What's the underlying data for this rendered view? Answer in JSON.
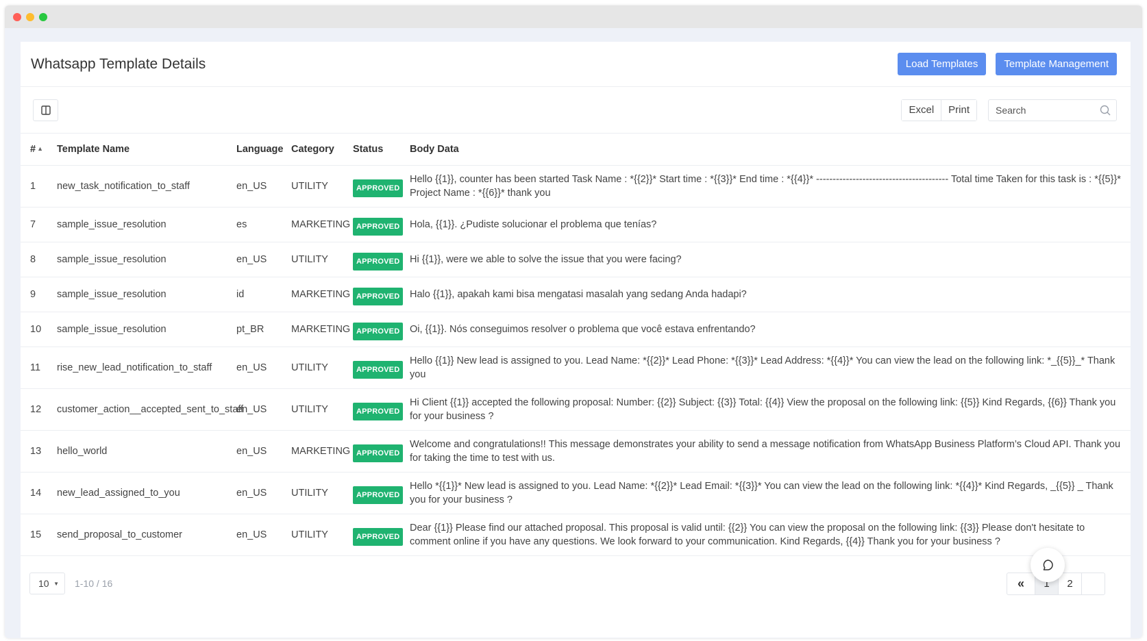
{
  "window": {
    "colors": {
      "close": "#ff5f57",
      "minimize": "#febc2e",
      "maximize": "#28c840"
    }
  },
  "header": {
    "title": "Whatsapp Template Details",
    "load_templates_label": "Load Templates",
    "template_management_label": "Template Management"
  },
  "toolbar": {
    "excel_label": "Excel",
    "print_label": "Print",
    "search_placeholder": "Search"
  },
  "table": {
    "columns": {
      "num": "#",
      "template_name": "Template Name",
      "language": "Language",
      "category": "Category",
      "status": "Status",
      "body": "Body Data"
    },
    "rows": [
      {
        "num": "1",
        "name": "new_task_notification_to_staff",
        "language": "en_US",
        "category": "UTILITY",
        "status": "APPROVED",
        "body": "Hello {{1}}, counter has been started Task Name : *{{2}}* Start time : *{{3}}* End time : *{{4}}* ---------------------------------------- Total time Taken for this task is : *{{5}}* Project Name : *{{6}}* thank you"
      },
      {
        "num": "7",
        "name": "sample_issue_resolution",
        "language": "es",
        "category": "MARKETING",
        "status": "APPROVED",
        "body": "Hola, {{1}}. ¿Pudiste solucionar el problema que tenías?"
      },
      {
        "num": "8",
        "name": "sample_issue_resolution",
        "language": "en_US",
        "category": "UTILITY",
        "status": "APPROVED",
        "body": "Hi {{1}}, were we able to solve the issue that you were facing?"
      },
      {
        "num": "9",
        "name": "sample_issue_resolution",
        "language": "id",
        "category": "MARKETING",
        "status": "APPROVED",
        "body": "Halo {{1}}, apakah kami bisa mengatasi masalah yang sedang Anda hadapi?"
      },
      {
        "num": "10",
        "name": "sample_issue_resolution",
        "language": "pt_BR",
        "category": "MARKETING",
        "status": "APPROVED",
        "body": "Oi, {{1}}. Nós conseguimos resolver o problema que você estava enfrentando?"
      },
      {
        "num": "11",
        "name": "rise_new_lead_notification_to_staff",
        "language": "en_US",
        "category": "UTILITY",
        "status": "APPROVED",
        "body": "Hello {{1}} New lead is assigned to you. Lead Name: *{{2}}* Lead Phone: *{{3}}* Lead Address: *{{4}}* You can view the lead on the following link: *_{{5}}_* Thank you"
      },
      {
        "num": "12",
        "name": "customer_action__accepted_sent_to_staff",
        "language": "en_US",
        "category": "UTILITY",
        "status": "APPROVED",
        "body": "Hi Client {{1}} accepted the following proposal: Number: {{2}} Subject: {{3}} Total: {{4}} View the proposal on the following link: {{5}} Kind Regards, {{6}} Thank you for your business ?"
      },
      {
        "num": "13",
        "name": "hello_world",
        "language": "en_US",
        "category": "MARKETING",
        "status": "APPROVED",
        "body": "Welcome and congratulations!! This message demonstrates your ability to send a message notification from WhatsApp Business Platform’s Cloud API. Thank you for taking the time to test with us."
      },
      {
        "num": "14",
        "name": "new_lead_assigned_to_you",
        "language": "en_US",
        "category": "UTILITY",
        "status": "APPROVED",
        "body": "Hello *{{1}}* New lead is assigned to you. Lead Name: *{{2}}* Lead Email: *{{3}}* You can view the lead on the following link: *{{4}}* Kind Regards, _{{5}} _ Thank you for your business ?"
      },
      {
        "num": "15",
        "name": "send_proposal_to_customer",
        "language": "en_US",
        "category": "UTILITY",
        "status": "APPROVED",
        "body": "Dear {{1}} Please find our attached proposal. This proposal is valid until: {{2}} You can view the proposal on the following link: {{3}} Please don't hesitate to comment online if you have any questions. We look forward to your communication. Kind Regards, {{4}} Thank you for your business ?"
      }
    ]
  },
  "footer": {
    "page_size": "10",
    "range": "1-10 / 16",
    "first_label": "«",
    "pages": [
      "1",
      "2"
    ]
  },
  "colors": {
    "primary_button": "#5b8def",
    "approved_badge": "#1fb370"
  }
}
